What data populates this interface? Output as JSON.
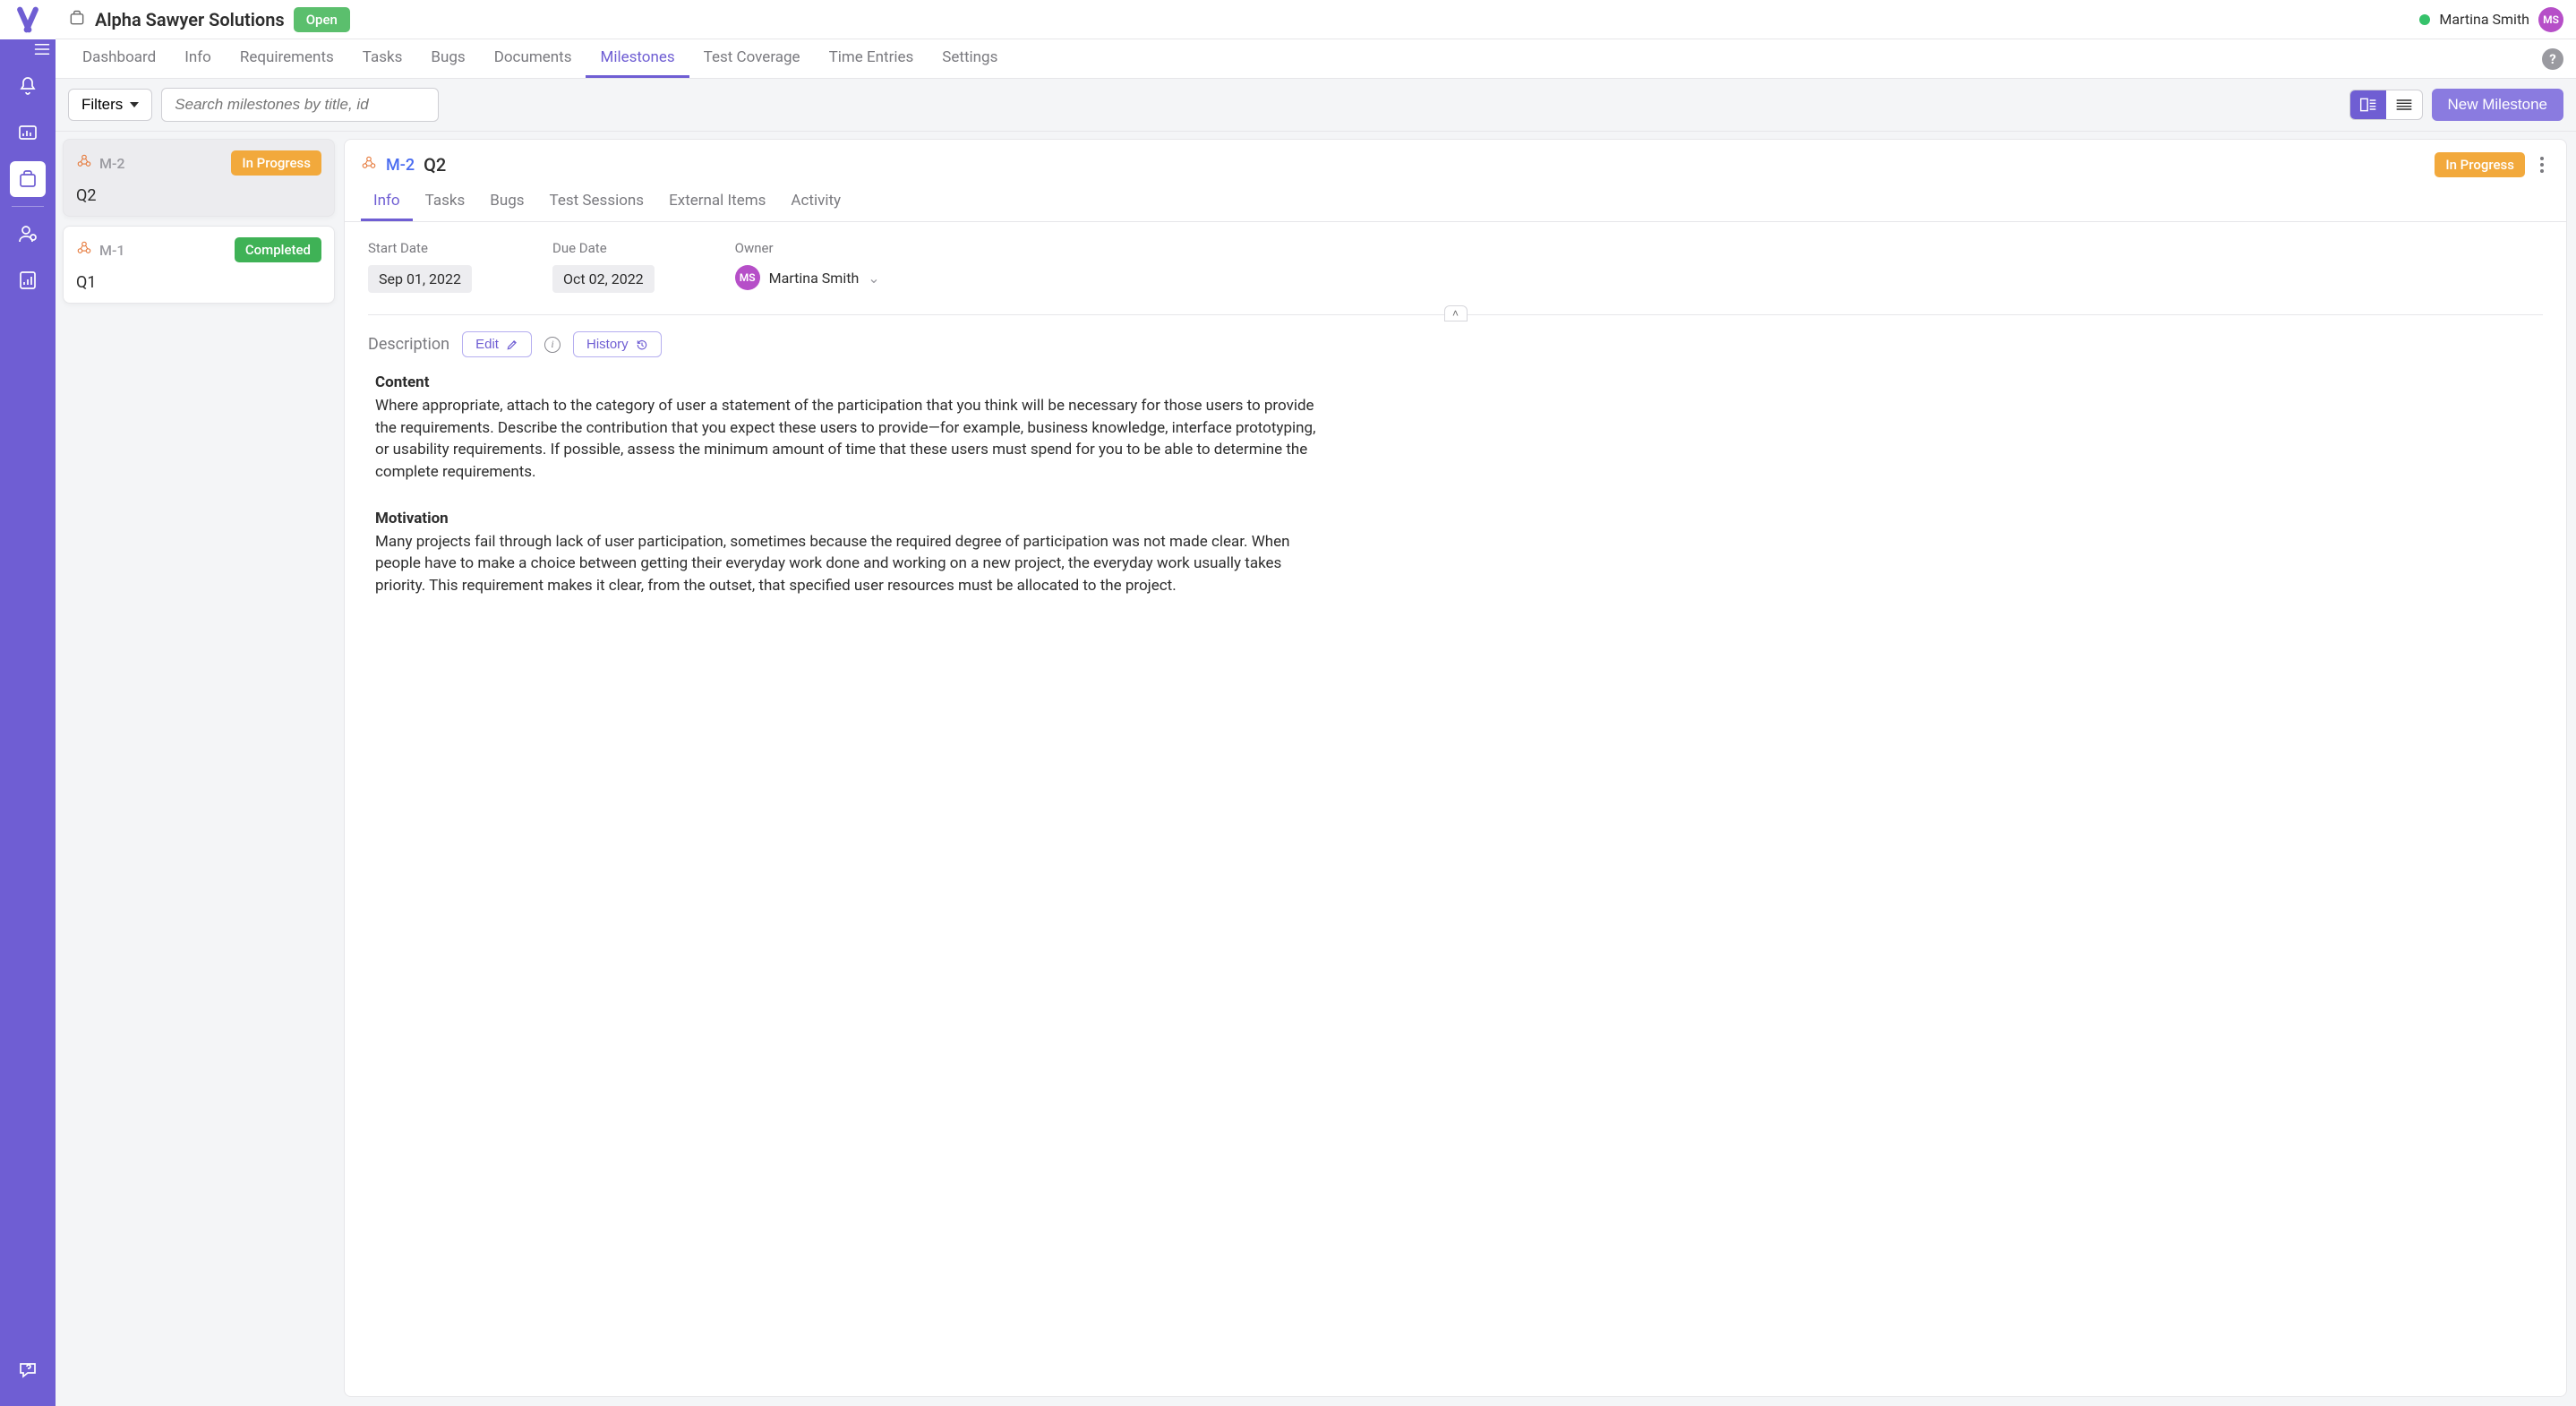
{
  "user": {
    "name": "Martina Smith",
    "initials": "MS"
  },
  "project": {
    "name": "Alpha Sawyer Solutions",
    "status_label": "Open"
  },
  "nav": {
    "tabs": [
      "Dashboard",
      "Info",
      "Requirements",
      "Tasks",
      "Bugs",
      "Documents",
      "Milestones",
      "Test Coverage",
      "Time Entries",
      "Settings"
    ],
    "active": "Milestones"
  },
  "toolbar": {
    "filters_label": "Filters",
    "search_placeholder": "Search milestones by title, id",
    "new_button": "New Milestone"
  },
  "milestone_list": [
    {
      "id": "M-2",
      "title": "Q2",
      "status": "In Progress",
      "status_kind": "progress",
      "selected": true
    },
    {
      "id": "M-1",
      "title": "Q1",
      "status": "Completed",
      "status_kind": "done",
      "selected": false
    }
  ],
  "detail": {
    "id": "M-2",
    "title": "Q2",
    "status": "In Progress",
    "tabs": [
      "Info",
      "Tasks",
      "Bugs",
      "Test Sessions",
      "External Items",
      "Activity"
    ],
    "active_tab": "Info",
    "start_date_label": "Start Date",
    "start_date": "Sep 01, 2022",
    "due_date_label": "Due Date",
    "due_date": "Oct 02, 2022",
    "owner_label": "Owner",
    "owner_name": "Martina Smith",
    "owner_initials": "MS",
    "description_label": "Description",
    "edit_label": "Edit",
    "history_label": "History",
    "sections": [
      {
        "heading": "Content",
        "body": "Where appropriate, attach to the category of user a statement of the participation that you think will be necessary for those users to provide the requirements. Describe the contribution that you expect these users to provide—for example, business knowledge, interface prototyping, or usability requirements. If possible, assess the minimum amount of time that these users must spend for you to be able to determine the complete requirements."
      },
      {
        "heading": "Motivation",
        "body": "Many projects fail through lack of user participation, sometimes because the required degree of participation was not made clear. When people have to make a choice between getting their everyday work done and working on a new project, the everyday work usually takes priority. This requirement makes it clear, from the outset, that specified user resources must be allocated to the project."
      }
    ]
  }
}
